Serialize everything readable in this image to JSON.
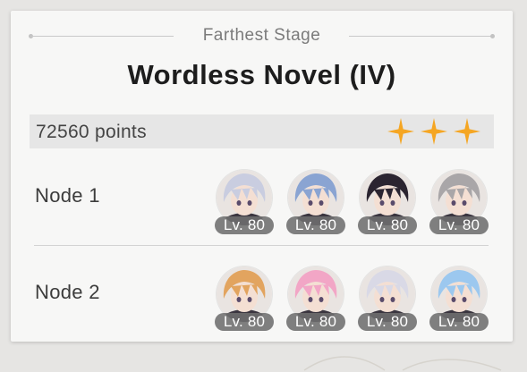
{
  "header": {
    "label": "Farthest Stage"
  },
  "stage": {
    "title": "Wordless Novel (IV)"
  },
  "score": {
    "text": "72560 points",
    "stars": 3,
    "star_color": "#f5a623"
  },
  "nodes": [
    {
      "label": "Node 1",
      "characters": [
        {
          "icon": "character-avatar-silver-hair",
          "hair": "#c9cde0",
          "level": "Lv. 80"
        },
        {
          "icon": "character-avatar-blue-hair",
          "hair": "#8aa4d2",
          "level": "Lv. 80"
        },
        {
          "icon": "character-avatar-dark-hair",
          "hair": "#2b2430",
          "level": "Lv. 80"
        },
        {
          "icon": "character-avatar-gray-hair",
          "hair": "#a9a6a8",
          "level": "Lv. 80"
        }
      ]
    },
    {
      "label": "Node 2",
      "characters": [
        {
          "icon": "character-avatar-blonde-hair",
          "hair": "#e2a45f",
          "level": "Lv. 80"
        },
        {
          "icon": "character-avatar-pink-hair",
          "hair": "#f2a6c6",
          "level": "Lv. 80"
        },
        {
          "icon": "character-avatar-white-hair",
          "hair": "#d9d9e6",
          "level": "Lv. 80"
        },
        {
          "icon": "character-avatar-light-blue-hair",
          "hair": "#9cc8ef",
          "level": "Lv. 80"
        }
      ]
    }
  ]
}
